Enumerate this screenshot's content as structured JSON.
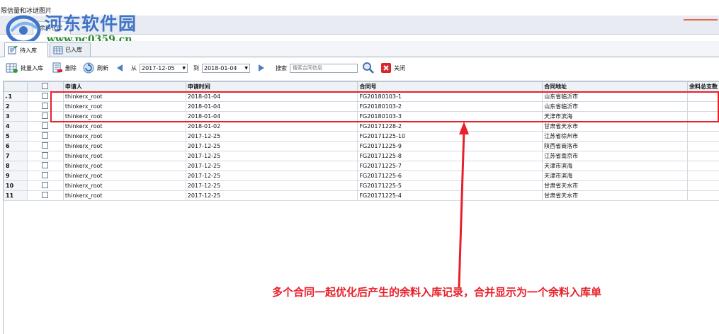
{
  "window": {
    "title": "限信量和冰谜图片",
    "doc_tab": "余料仓库"
  },
  "watermark": {
    "site_name": "河东软件园",
    "url": "www.pc0359.cn"
  },
  "subtabs": [
    {
      "label": "待入库"
    },
    {
      "label": "已入库"
    }
  ],
  "toolbar": {
    "batch_label": "批量入库",
    "delete_label": "删除",
    "refresh_label": "刷新",
    "from_label": "从",
    "from_date": "2017-12-05",
    "to_label": "到",
    "to_date": "2018-01-04",
    "search_label": "搜索",
    "search_placeholder": "搜索合同信息",
    "close_label": "关闭"
  },
  "grid": {
    "columns": [
      "申请人",
      "申请时间",
      "合同号",
      "合同地址",
      "余料总支数"
    ],
    "rows": [
      {
        "n": "1",
        "applicant": "thinkerx_root",
        "date": "2018-01-04",
        "contract": "FG20180103-1",
        "address": "山东省临沂市"
      },
      {
        "n": "2",
        "applicant": "thinkerx_root",
        "date": "2018-01-04",
        "contract": "FG20180103-2",
        "address": "山东省临沂市"
      },
      {
        "n": "3",
        "applicant": "thinkerx_root",
        "date": "2018-01-04",
        "contract": "FG20180103-3",
        "address": "天津市滨海"
      },
      {
        "n": "4",
        "applicant": "thinkerx_root",
        "date": "2018-01-02",
        "contract": "FG20171228-2",
        "address": "甘肃省天水市"
      },
      {
        "n": "5",
        "applicant": "thinkerx_root",
        "date": "2017-12-25",
        "contract": "FG20171225-10",
        "address": "江苏省徐州市"
      },
      {
        "n": "6",
        "applicant": "thinkerx_root",
        "date": "2017-12-25",
        "contract": "FG20171225-9",
        "address": "陕西省商洛市"
      },
      {
        "n": "7",
        "applicant": "thinkerx_root",
        "date": "2017-12-25",
        "contract": "FG20171225-8",
        "address": "江苏省南京市"
      },
      {
        "n": "8",
        "applicant": "thinkerx_root",
        "date": "2017-12-25",
        "contract": "FG20171225-7",
        "address": "天津市滨海"
      },
      {
        "n": "9",
        "applicant": "thinkerx_root",
        "date": "2017-12-25",
        "contract": "FG20171225-6",
        "address": "天津市滨海"
      },
      {
        "n": "10",
        "applicant": "thinkerx_root",
        "date": "2017-12-25",
        "contract": "FG20171225-5",
        "address": "甘肃省天水市"
      },
      {
        "n": "11",
        "applicant": "thinkerx_root",
        "date": "2017-12-25",
        "contract": "FG20171225-4",
        "address": "甘肃省天水市"
      }
    ]
  },
  "annotation": {
    "text": "多个合同一起优化后产生的余料入库记录，合并显示为一个余料入库单",
    "color": "#e8202b"
  },
  "colors": {
    "accent": "#3f74c8",
    "highlight": "#e8202b"
  }
}
